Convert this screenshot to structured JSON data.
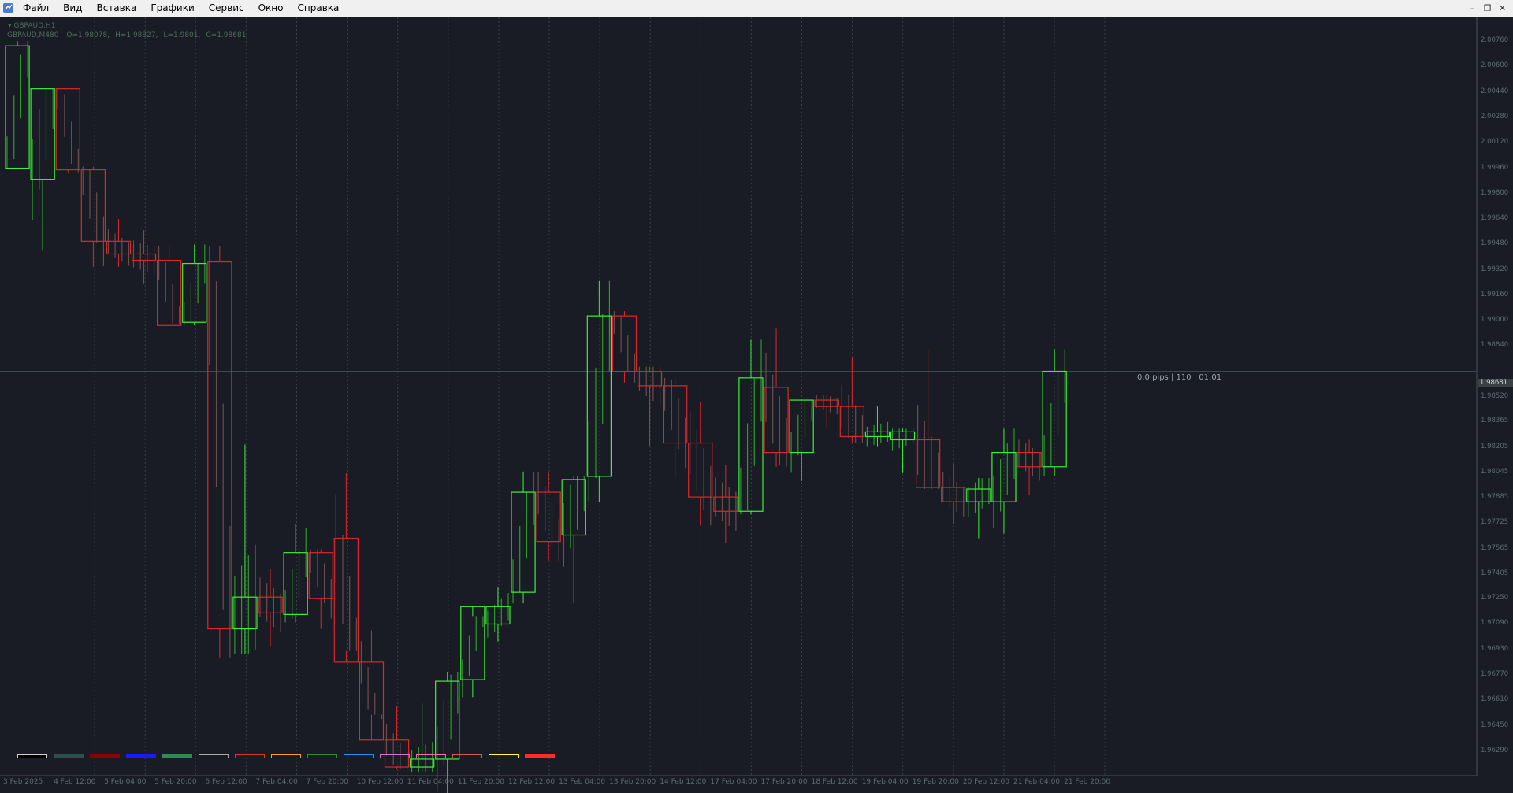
{
  "menu": {
    "items": [
      "Файл",
      "Вид",
      "Вставка",
      "Графики",
      "Сервис",
      "Окно",
      "Справка"
    ]
  },
  "window_controls": [
    "minimize-icon",
    "restore-icon",
    "close-icon"
  ],
  "chart": {
    "symbol_title": "GBPAUD,H1",
    "overlay_timeframe": "GBPAUD,M480",
    "open": "O=1.98078,",
    "high": "H=1.98827,",
    "low": "L=1.9801,",
    "close": "C=1.98681",
    "status_text": "0.0 pips | 110 | 01:01",
    "current_price": "1.98681",
    "price_labels": [
      "2.00760",
      "2.00600",
      "2.00440",
      "2.00280",
      "2.00120",
      "1.99960",
      "1.99800",
      "1.99640",
      "1.99480",
      "1.99320",
      "1.99160",
      "1.99000",
      "1.98840",
      "1.98520",
      "1.98365",
      "1.98205",
      "1.98045",
      "1.97885",
      "1.97725",
      "1.97565",
      "1.97405",
      "1.97250",
      "1.97090",
      "1.96930",
      "1.96770",
      "1.96610",
      "1.96450",
      "1.96290"
    ],
    "time_labels": [
      "3 Feb 2025",
      "4 Feb 12:00",
      "5 Feb 04:00",
      "5 Feb 20:00",
      "6 Feb 12:00",
      "7 Feb 04:00",
      "7 Feb 20:00",
      "10 Feb 12:00",
      "11 Feb 04:00",
      "11 Feb 20:00",
      "12 Feb 12:00",
      "13 Feb 04:00",
      "13 Feb 20:00",
      "14 Feb 12:00",
      "17 Feb 04:00",
      "17 Feb 20:00",
      "18 Feb 12:00",
      "19 Feb 04:00",
      "19 Feb 20:00",
      "20 Feb 12:00",
      "21 Feb 04:00",
      "21 Feb 20:00"
    ],
    "colors": {
      "background": "#191c24",
      "bull_outline": "#3fef3a",
      "bear_outline": "#e0262b",
      "small_bull": "#2a9a2a",
      "small_bear": "#6a4d4d",
      "grid": "#3a3f47"
    },
    "legend_swatches": [
      {
        "color": "#000000",
        "border": "#cfcfcf"
      },
      {
        "color": "#2f4f4f",
        "border": "#2f4f4f"
      },
      {
        "color": "#8b0000",
        "border": "#8b0000"
      },
      {
        "color": "#1a1aff",
        "border": "#1a1aff"
      },
      {
        "color": "#2e8b57",
        "border": "#2e8b57"
      },
      {
        "color": "transparent",
        "border": "#a9a9a9"
      },
      {
        "color": "transparent",
        "border": "#d9342b"
      },
      {
        "color": "transparent",
        "border": "#ff9f1a"
      },
      {
        "color": "transparent",
        "border": "#2e8b3a"
      },
      {
        "color": "transparent",
        "border": "#1e90ff"
      },
      {
        "color": "transparent",
        "border": "#da70d6"
      },
      {
        "color": "transparent",
        "border": "#ff69b4"
      },
      {
        "color": "transparent",
        "border": "#cd5c5c"
      },
      {
        "color": "transparent",
        "border": "#ffff33"
      },
      {
        "color": "#ff2a2a",
        "border": "#ff2a2a"
      }
    ]
  },
  "chart_data": {
    "type": "candlestick",
    "xlabel": "",
    "ylabel": "",
    "ylim": [
      1.9621,
      2.00855
    ],
    "timeframe": "M480 overlay on H1",
    "candles": [
      {
        "o": 1.9996,
        "h": 2.0076,
        "l": 1.9996,
        "c": 2.0073
      },
      {
        "o": 1.9989,
        "h": 2.0046,
        "l": 1.9944,
        "c": 2.0046
      },
      {
        "o": 2.0046,
        "h": 2.0046,
        "l": 1.9993,
        "c": 1.9995
      },
      {
        "o": 1.9995,
        "h": 1.9997,
        "l": 1.9934,
        "c": 1.995
      },
      {
        "o": 1.995,
        "h": 1.9964,
        "l": 1.9934,
        "c": 1.9942
      },
      {
        "o": 1.9942,
        "h": 1.9957,
        "l": 1.9923,
        "c": 1.9938
      },
      {
        "o": 1.9938,
        "h": 1.9947,
        "l": 1.9898,
        "c": 1.9897
      },
      {
        "o": 1.9899,
        "h": 1.9948,
        "l": 1.9897,
        "c": 1.9936
      },
      {
        "o": 1.9937,
        "h": 1.9947,
        "l": 1.9688,
        "c": 1.9706
      },
      {
        "o": 1.9706,
        "h": 1.9822,
        "l": 1.969,
        "c": 1.9726
      },
      {
        "o": 1.9726,
        "h": 1.9744,
        "l": 1.9695,
        "c": 1.9716
      },
      {
        "o": 1.9715,
        "h": 1.9772,
        "l": 1.971,
        "c": 1.9754
      },
      {
        "o": 1.9754,
        "h": 1.9756,
        "l": 1.9706,
        "c": 1.9725
      },
      {
        "o": 1.9763,
        "h": 1.9804,
        "l": 1.9692,
        "c": 1.9685
      },
      {
        "o": 1.9685,
        "h": 1.9705,
        "l": 1.9652,
        "c": 1.9636
      },
      {
        "o": 1.9636,
        "h": 1.9657,
        "l": 1.9618,
        "c": 1.9619
      },
      {
        "o": 1.9619,
        "h": 1.9659,
        "l": 1.9616,
        "c": 1.9624
      },
      {
        "o": 1.9624,
        "h": 1.9679,
        "l": 1.9597,
        "c": 1.9673
      },
      {
        "o": 1.9674,
        "h": 1.9714,
        "l": 1.9663,
        "c": 1.972
      },
      {
        "o": 1.9709,
        "h": 1.9732,
        "l": 1.9698,
        "c": 1.972
      },
      {
        "o": 1.9729,
        "h": 1.9805,
        "l": 1.9722,
        "c": 1.9792
      },
      {
        "o": 1.9792,
        "h": 1.9805,
        "l": 1.9749,
        "c": 1.9761
      },
      {
        "o": 1.9765,
        "h": 1.9802,
        "l": 1.9722,
        "c": 1.98
      },
      {
        "o": 1.9802,
        "h": 1.9925,
        "l": 1.9786,
        "c": 1.9903
      },
      {
        "o": 1.9903,
        "h": 1.9906,
        "l": 1.9861,
        "c": 1.9868
      },
      {
        "o": 1.9868,
        "h": 1.9871,
        "l": 1.9821,
        "c": 1.9859
      },
      {
        "o": 1.9859,
        "h": 1.9864,
        "l": 1.9801,
        "c": 1.9823
      },
      {
        "o": 1.9823,
        "h": 1.9849,
        "l": 1.9771,
        "c": 1.9789
      },
      {
        "o": 1.9789,
        "h": 1.9809,
        "l": 1.976,
        "c": 1.978
      },
      {
        "o": 1.978,
        "h": 1.9888,
        "l": 1.9778,
        "c": 1.9864
      },
      {
        "o": 1.9858,
        "h": 1.9895,
        "l": 1.9808,
        "c": 1.9817
      },
      {
        "o": 1.9817,
        "h": 1.985,
        "l": 1.9799,
        "c": 1.985
      },
      {
        "o": 1.985,
        "h": 1.9853,
        "l": 1.9833,
        "c": 1.9846
      },
      {
        "o": 1.9846,
        "h": 1.9877,
        "l": 1.9823,
        "c": 1.9827
      },
      {
        "o": 1.9827,
        "h": 1.9846,
        "l": 1.9821,
        "c": 1.983
      },
      {
        "o": 1.9825,
        "h": 1.9832,
        "l": 1.9804,
        "c": 1.983
      },
      {
        "o": 1.9825,
        "h": 1.9882,
        "l": 1.9794,
        "c": 1.9795
      },
      {
        "o": 1.9795,
        "h": 1.981,
        "l": 1.9772,
        "c": 1.9786
      },
      {
        "o": 1.9786,
        "h": 1.9801,
        "l": 1.9763,
        "c": 1.9794
      },
      {
        "o": 1.9786,
        "h": 1.9832,
        "l": 1.9766,
        "c": 1.9817
      },
      {
        "o": 1.9817,
        "h": 1.9825,
        "l": 1.979,
        "c": 1.9808
      },
      {
        "o": 1.9808,
        "h": 1.9882,
        "l": 1.9802,
        "c": 1.98681
      }
    ]
  }
}
